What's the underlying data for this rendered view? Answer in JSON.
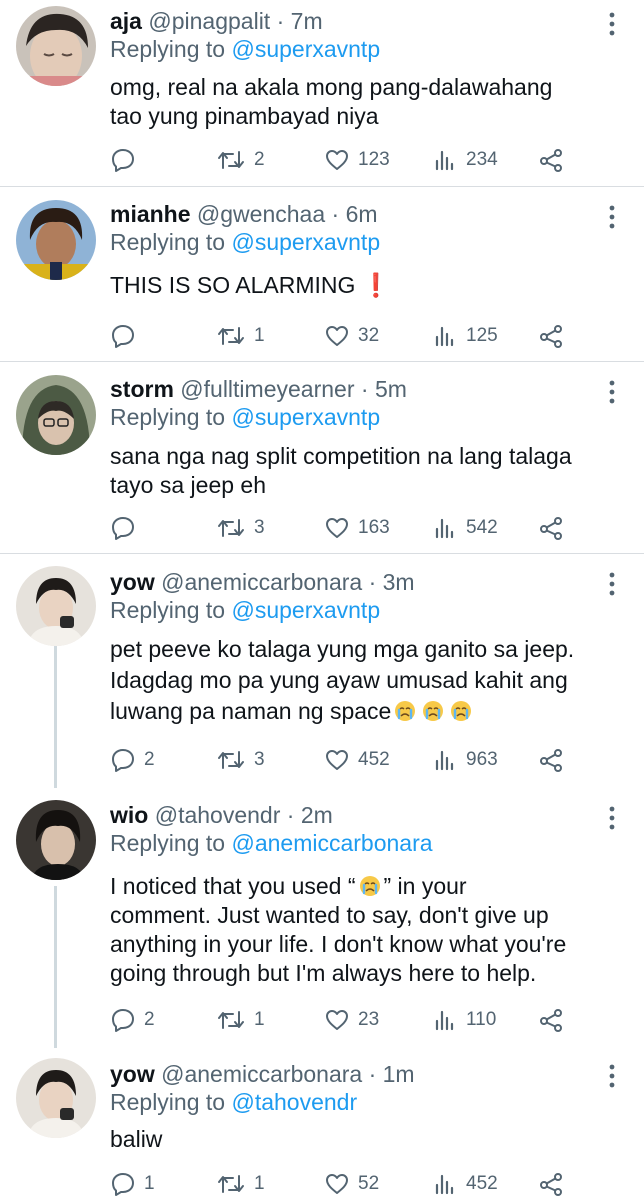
{
  "replying_prefix": "Replying to",
  "tweets": [
    {
      "name": "aja",
      "handle": "@pinagpalit",
      "sep": "·",
      "time": "7m",
      "reply_to": "@superxavntp",
      "lines": [
        "omg, real na akala mong pang-dalawahang",
        "tao yung pinambayad niya"
      ],
      "replies": "",
      "retweets": "2",
      "likes": "123",
      "views": "234"
    },
    {
      "name": "mianhe",
      "handle": "@gwenchaa",
      "sep": "·",
      "time": "6m",
      "reply_to": "@superxavntp",
      "lines": [
        "THIS IS SO ALARMING ❗"
      ],
      "replies": "",
      "retweets": "1",
      "likes": "32",
      "views": "125"
    },
    {
      "name": "storm",
      "handle": "@fulltimeyearner",
      "sep": "·",
      "time": "5m",
      "reply_to": "@superxavntp",
      "lines": [
        "sana nga nag split competition na lang talaga",
        "tayo sa jeep eh"
      ],
      "replies": "",
      "retweets": "3",
      "likes": "163",
      "views": "542"
    },
    {
      "name": "yow",
      "handle": "@anemiccarbonara",
      "sep": "·",
      "time": "3m",
      "reply_to": "@superxavntp",
      "lines": [
        "pet peeve ko talaga yung mga ganito sa jeep.",
        "Idagdag mo pa yung ayaw umusad kahit ang",
        "luwang pa naman ng space"
      ],
      "replies": "2",
      "retweets": "3",
      "likes": "452",
      "views": "963"
    },
    {
      "name": "wio",
      "handle": "@tahovendr",
      "sep": "·",
      "time": "2m",
      "reply_to": "@anemiccarbonara",
      "lines": [
        "I noticed that you used “",
        "” in your",
        "comment. Just wanted to say, don't give up",
        "anything in your life. I don't know what you're",
        "going through but I'm always here to help."
      ],
      "replies": "2",
      "retweets": "1",
      "likes": "23",
      "views": "110"
    },
    {
      "name": "yow",
      "handle": "@anemiccarbonara",
      "sep": "·",
      "time": "1m",
      "reply_to": "@tahovendr",
      "lines": [
        "baliw"
      ],
      "replies": "1",
      "retweets": "1",
      "likes": "52",
      "views": "452"
    }
  ]
}
